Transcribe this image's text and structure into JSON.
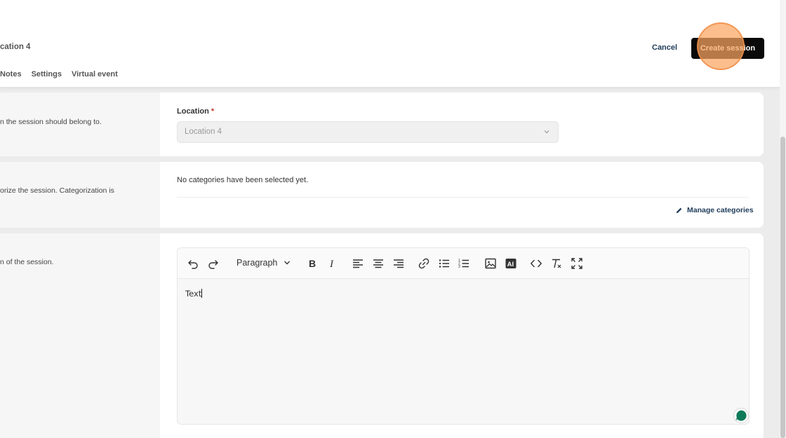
{
  "header": {
    "breadcrumb": "cation 4",
    "tabs": [
      "Notes",
      "Settings",
      "Virtual event"
    ],
    "cancel_label": "Cancel",
    "create_label": "Create session"
  },
  "location_section": {
    "description": "n the session should belong to.",
    "label": "Location",
    "required_mark": "*",
    "selected_value": "Location 4"
  },
  "categories_section": {
    "description": "orize the session. Categorization is",
    "empty_text": "No categories have been selected yet.",
    "manage_label": "Manage categories"
  },
  "description_section": {
    "description": "n of the session.",
    "paragraph_label": "Paragraph",
    "editor_text": "Text",
    "toolbar_icons": [
      "undo-icon",
      "redo-icon",
      "bold-icon",
      "italic-icon",
      "align-left-icon",
      "align-center-icon",
      "align-right-icon",
      "link-icon",
      "bullet-list-icon",
      "numbered-list-icon",
      "image-icon",
      "ai-icon",
      "code-icon",
      "clear-format-icon",
      "fullscreen-icon"
    ]
  },
  "colors": {
    "primary_button": "#0a0a0a",
    "link": "#1f3c5a",
    "required": "#c0392b",
    "chat": "#0f7a5a"
  }
}
